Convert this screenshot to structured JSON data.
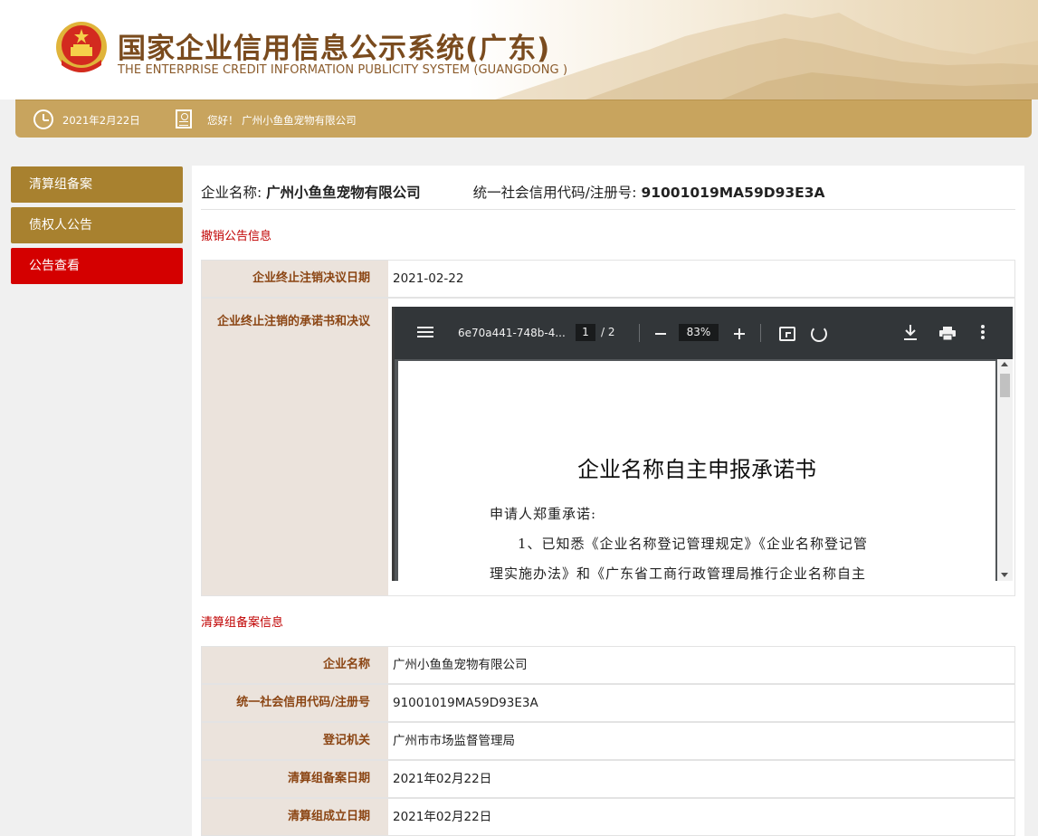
{
  "header": {
    "title_cn": "国家企业信用信息公示系统(广东)",
    "title_en": "THE ENTERPRISE CREDIT INFORMATION PUBLICITY SYSTEM (GUANGDONG )"
  },
  "topbar": {
    "date": "2021年2月22日",
    "greeting": "您好！ 广州小鱼鱼宠物有限公司"
  },
  "sidebar": {
    "items": [
      {
        "label": "清算组备案",
        "active": false
      },
      {
        "label": "债权人公告",
        "active": false
      },
      {
        "label": "公告查看",
        "active": true
      }
    ]
  },
  "company": {
    "name_label": "企业名称:",
    "name": "广州小鱼鱼宠物有限公司",
    "code_label": "统一社会信用代码/注册号:",
    "code": "91001019MA59D93E3A"
  },
  "revoke_section": {
    "title": "撤销公告信息",
    "rows": [
      {
        "label": "企业终止注销决议日期",
        "value": "2021-02-22"
      },
      {
        "label": "企业终止注销的承诺书和决议",
        "value": ""
      }
    ]
  },
  "pdf": {
    "filename": "6e70a441-748b-4...",
    "page": "1",
    "page_total": "/  2",
    "zoom": "83%",
    "doc_title": "企业名称自主申报承诺书",
    "lines": [
      "申请人郑重承诺:",
      "1、已知悉《企业名称登记管理规定》《企业名称登记管",
      "理实施办法》和《广东省工商行政管理局推行企业名称自主"
    ]
  },
  "liquidation_section": {
    "title": "清算组备案信息",
    "rows": [
      {
        "label": "企业名称",
        "value": "广州小鱼鱼宠物有限公司"
      },
      {
        "label": "统一社会信用代码/注册号",
        "value": "91001019MA59D93E3A"
      },
      {
        "label": "登记机关",
        "value": "广州市市场监督管理局"
      },
      {
        "label": "清算组备案日期",
        "value": "2021年02月22日"
      },
      {
        "label": "清算组成立日期",
        "value": "2021年02月22日"
      }
    ]
  },
  "colors": {
    "gold": "#c8a45e",
    "sidebar": "#a8812f",
    "active": "#d40000",
    "section_title": "#c00000",
    "label_text": "#8b4513"
  }
}
